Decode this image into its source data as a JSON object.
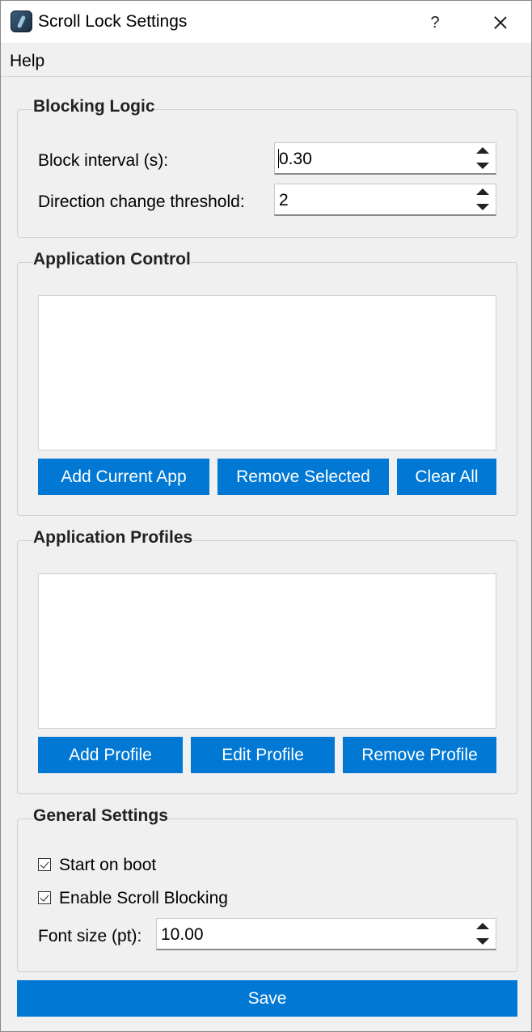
{
  "window": {
    "title": "Scroll Lock Settings",
    "help_glyph": "?",
    "close_icon": "close-icon",
    "app_icon": "scroll-lock-app-icon"
  },
  "menu": {
    "items": [
      {
        "label": "Help"
      }
    ]
  },
  "blocking_logic": {
    "title": "Blocking Logic",
    "block_interval": {
      "label": "Block interval (s):",
      "value": "0.30"
    },
    "direction_threshold": {
      "label": "Direction change threshold:",
      "value": "2"
    }
  },
  "application_control": {
    "title": "Application Control",
    "items": [],
    "buttons": {
      "add_current": "Add Current App",
      "remove_selected": "Remove Selected",
      "clear_all": "Clear All"
    }
  },
  "application_profiles": {
    "title": "Application Profiles",
    "items": [],
    "buttons": {
      "add": "Add Profile",
      "edit": "Edit Profile",
      "remove": "Remove Profile"
    }
  },
  "general_settings": {
    "title": "General Settings",
    "start_on_boot": {
      "label": "Start on boot",
      "checked": true
    },
    "enable_scroll_blocking": {
      "label": "Enable Scroll Blocking",
      "checked": true
    },
    "font_size": {
      "label": "Font size (pt):",
      "value": "10.00"
    }
  },
  "save_label": "Save",
  "colors": {
    "accent": "#0078d4",
    "background": "#f0f0f0",
    "titlebar": "#ffffff"
  }
}
